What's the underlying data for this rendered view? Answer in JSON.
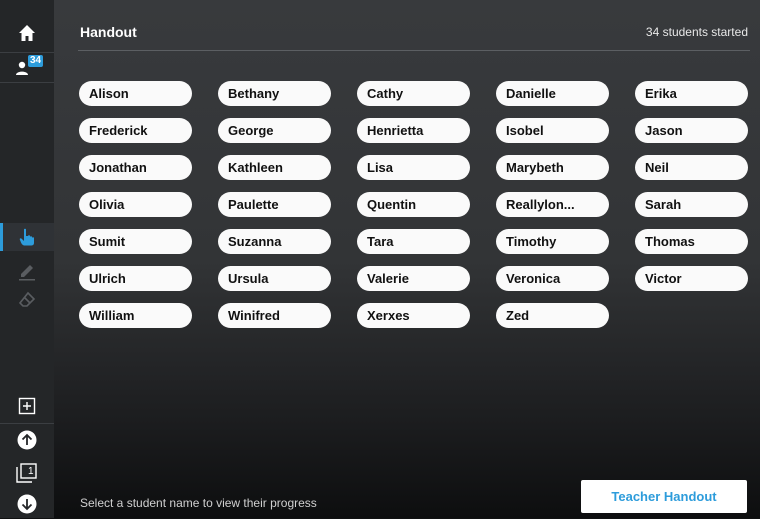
{
  "header": {
    "title": "Handout",
    "status": "34 students started"
  },
  "sidebar": {
    "user_count": "34",
    "page_number": "1",
    "icons": [
      "home-icon",
      "users-icon",
      "hand-pointer-icon",
      "pencil-icon",
      "eraser-icon",
      "add-page-icon",
      "arrow-up-icon",
      "page-icon",
      "arrow-down-icon"
    ]
  },
  "students": [
    "Alison",
    "Bethany",
    "Cathy",
    "Danielle",
    "Erika",
    "Frederick",
    "George",
    "Henrietta",
    "Isobel",
    "Jason",
    "Jonathan",
    "Kathleen",
    "Lisa",
    "Marybeth",
    "Neil",
    "Olivia",
    "Paulette",
    "Quentin",
    "Reallylon...",
    "Sarah",
    "Sumit",
    "Suzanna",
    "Tara",
    "Timothy",
    "Thomas",
    "Ulrich",
    "Ursula",
    "Valerie",
    "Veronica",
    "Victor",
    "William",
    "Winifred",
    "Xerxes",
    "Zed"
  ],
  "footer": {
    "hint": "Select a student name to view their progress",
    "teacher_button": "Teacher Handout"
  },
  "colors": {
    "accent": "#2d9cdb",
    "sidebar": "#242628",
    "pill": "#fafafa"
  }
}
